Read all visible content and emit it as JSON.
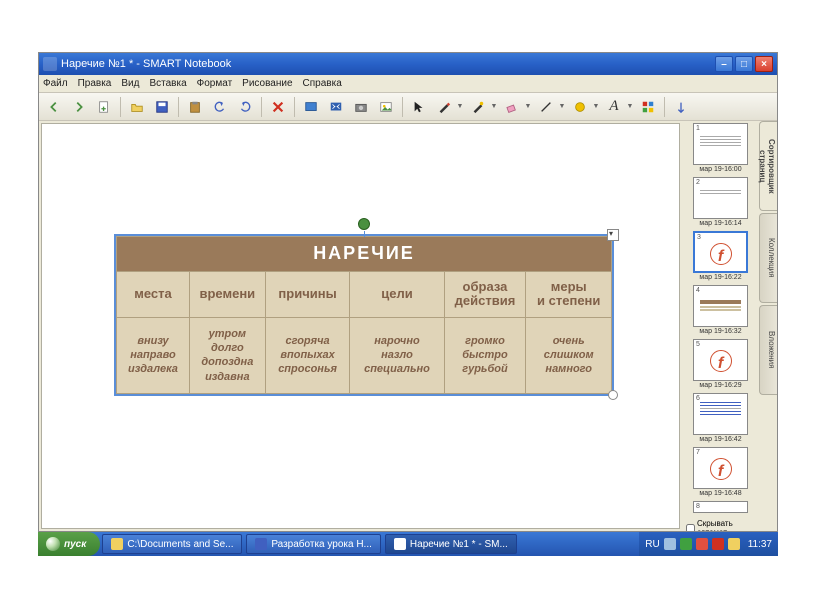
{
  "window": {
    "title": "Наречие №1 * - SMART Notebook"
  },
  "menu": {
    "file": "Файл",
    "edit": "Правка",
    "view": "Вид",
    "insert": "Вставка",
    "format": "Формат",
    "draw": "Рисование",
    "help": "Справка"
  },
  "side": {
    "tab_sorter": "Сортировщик страниц",
    "tab_collection": "Коллекция",
    "tab_attachments": "Вложения",
    "hide_auto": "Скрывать автомат"
  },
  "thumbs": [
    {
      "num": "1",
      "label": "мар 19-16:00"
    },
    {
      "num": "2",
      "label": "мар 19-16:14"
    },
    {
      "num": "3",
      "label": "мар 19-16:22"
    },
    {
      "num": "4",
      "label": "мар 19-16:32"
    },
    {
      "num": "5",
      "label": "мар 19-16:29"
    },
    {
      "num": "6",
      "label": "мар 19-16:42"
    },
    {
      "num": "7",
      "label": "мар 19-16:48"
    },
    {
      "num": "8",
      "label": ""
    }
  ],
  "table": {
    "title": "НАРЕЧИЕ",
    "headers": [
      "места",
      "времени",
      "причины",
      "цели",
      "образа действия",
      "меры и степени"
    ],
    "cells": [
      "внизу направо издалека",
      "утром долго допоздна издавна",
      "сгоряча впопыхах спросонья",
      "нарочно назло специально",
      "громко быстро гурьбой",
      "очень слишком намного"
    ]
  },
  "taskbar": {
    "start": "пуск",
    "items": [
      "C:\\Documents and Se...",
      "Разработка урока Н...",
      "Наречие №1 * - SM..."
    ],
    "lang": "RU",
    "clock": "11:37"
  }
}
